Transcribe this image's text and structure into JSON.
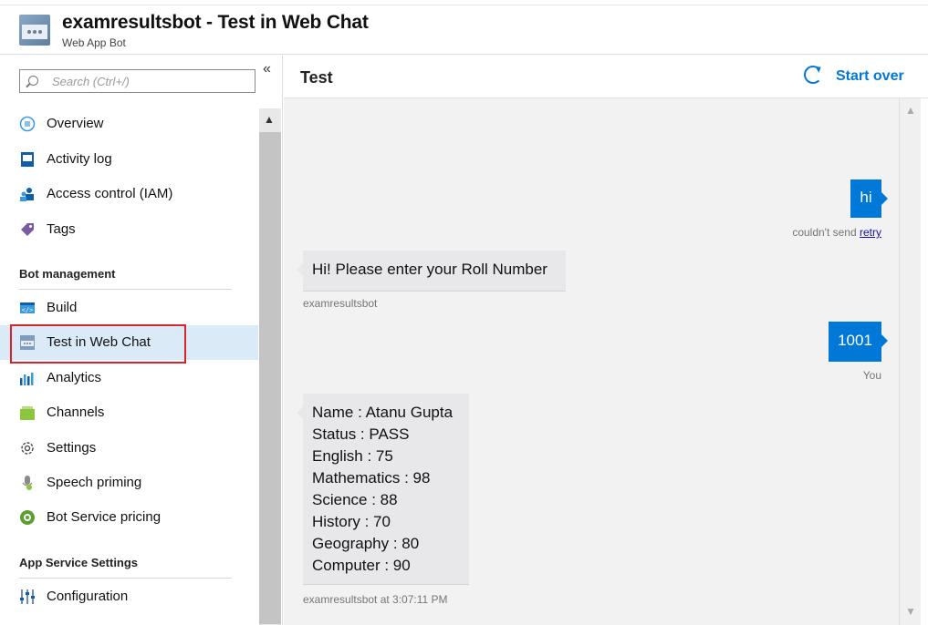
{
  "header": {
    "title": "examresultsbot - Test in Web Chat",
    "subtitle": "Web App Bot",
    "icon": "web-app-bot-icon"
  },
  "sidebar": {
    "search_placeholder": "Search (Ctrl+/)",
    "collapse": "«",
    "items_top": [
      {
        "label": "Overview",
        "icon": "overview-icon"
      },
      {
        "label": "Activity log",
        "icon": "activity-log-icon"
      },
      {
        "label": "Access control (IAM)",
        "icon": "access-control-icon"
      },
      {
        "label": "Tags",
        "icon": "tag-icon"
      }
    ],
    "section_bot": "Bot management",
    "items_bot": [
      {
        "label": "Build",
        "icon": "build-icon"
      },
      {
        "label": "Test in Web Chat",
        "icon": "web-chat-icon",
        "active": true
      },
      {
        "label": "Analytics",
        "icon": "analytics-icon"
      },
      {
        "label": "Channels",
        "icon": "channels-icon"
      },
      {
        "label": "Settings",
        "icon": "gear-icon"
      },
      {
        "label": "Speech priming",
        "icon": "speech-priming-icon"
      },
      {
        "label": "Bot Service pricing",
        "icon": "pricing-icon"
      }
    ],
    "section_app": "App Service Settings",
    "items_app": [
      {
        "label": "Configuration",
        "icon": "configuration-icon"
      }
    ]
  },
  "main": {
    "title": "Test",
    "start_over": "Start over"
  },
  "chat": {
    "messages": [
      {
        "from": "user",
        "text": "hi",
        "status": "couldn't send",
        "action": "retry"
      },
      {
        "from": "bot",
        "lines": [
          "Hi! Please enter your Roll Number"
        ],
        "meta": "examresultsbot"
      },
      {
        "from": "user",
        "text": "1001",
        "meta": "You"
      },
      {
        "from": "bot",
        "lines": [
          "Name : Atanu Gupta",
          "Status : PASS",
          "English : 75",
          "Mathematics : 98",
          "Science : 88",
          "History : 70",
          "Geography : 80",
          "Computer : 90"
        ],
        "meta": "examresultsbot at 3:07:11 PM"
      }
    ]
  },
  "colors": {
    "accent": "#0078d4",
    "user_bubble": "#0078d7",
    "bot_bubble": "#e8e8ea",
    "active_item_bg": "#dbeaf7",
    "highlight_border": "#d9232e"
  }
}
